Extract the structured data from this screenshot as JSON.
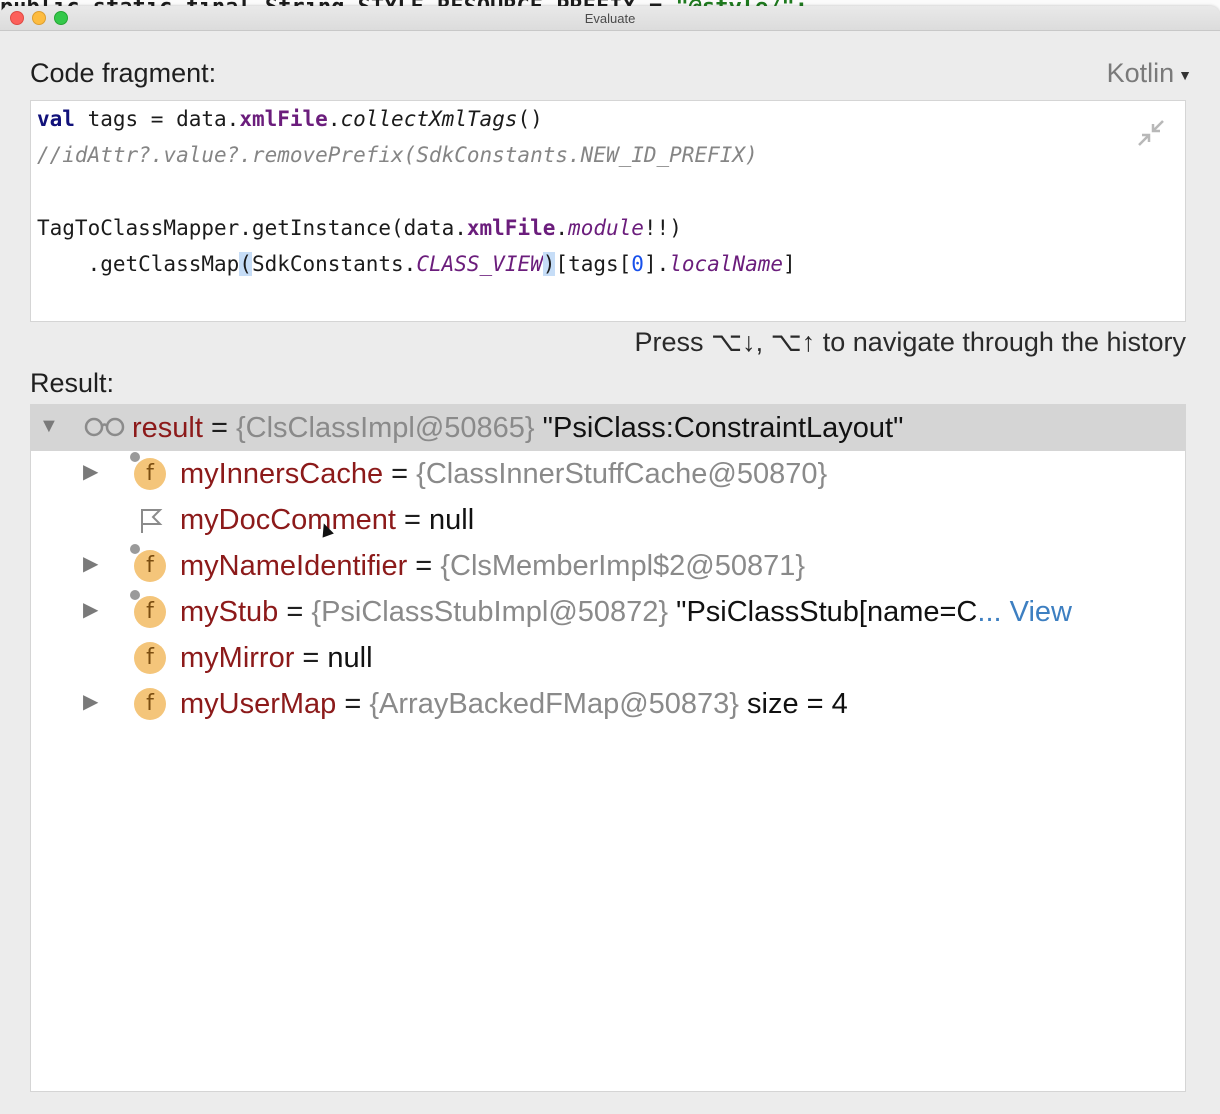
{
  "background_editor": {
    "text_left": "public static final String STYLE_RESOURCE_PREFIX = ",
    "text_string": "\"@style/\";"
  },
  "window": {
    "title": "Evaluate"
  },
  "code_fragment": {
    "label": "Code fragment:",
    "language": "Kotlin",
    "lines": {
      "l1": {
        "kw": "val",
        "a": " tags = data.",
        "prop": "xmlFile",
        "b": ".",
        "ext": "collectXmlTags",
        "c": "()"
      },
      "l2": {
        "comment": "//idAttr?.value?.removePrefix(SdkConstants.NEW_ID_PREFIX)"
      },
      "l4": {
        "a": "TagToClassMapper.getInstance(data.",
        "prop": "xmlFile",
        "b": ".",
        "ext": "module",
        "c": "!!)"
      },
      "l5": {
        "a": "    .getClassMap",
        "p1": "(",
        "b": "SdkConstants.",
        "const": "CLASS_VIEW",
        "p2": ")",
        "c": "[tags[",
        "num": "0",
        "d": "].",
        "ext": "localName",
        "e": "]"
      }
    }
  },
  "history_hint": "Press ⌥↓, ⌥↑ to navigate through the history",
  "result": {
    "label": "Result:",
    "root": {
      "name": "result",
      "eq": " = ",
      "type": "{ClsClassImpl@50865}",
      "value": " \"PsiClass:ConstraintLayout\""
    },
    "children": [
      {
        "name": "myInnersCache",
        "eq": " = ",
        "type": "{ClassInnerStuffCache@50870}",
        "value": ""
      },
      {
        "name": "myDocComment",
        "eq": " = ",
        "type": "",
        "value": "null"
      },
      {
        "name": "myNameIdentifier",
        "eq": " = ",
        "type": "{ClsMemberImpl$2@50871}",
        "value": ""
      },
      {
        "name": "myStub",
        "eq": " = ",
        "type": "{PsiClassStubImpl@50872}",
        "value": " \"PsiClassStub[name=C",
        "more": "... View"
      },
      {
        "name": "myMirror",
        "eq": " = ",
        "type": "",
        "value": "null"
      },
      {
        "name": "myUserMap",
        "eq": " = ",
        "type": "{ArrayBackedFMap@50873}",
        "value": " size = 4"
      }
    ]
  },
  "icons": {
    "expanded": "triangle-down-icon",
    "collapsed": "triangle-right-icon",
    "field": "f",
    "watch": "glasses-icon",
    "flag": "flag-icon",
    "collapse": "collapse-arrows-icon"
  },
  "colors": {
    "field_icon": "#f4c57a",
    "field_name": "#8c1a1a",
    "selected_row": "#d5d5d5",
    "link": "#3d7fc1"
  }
}
